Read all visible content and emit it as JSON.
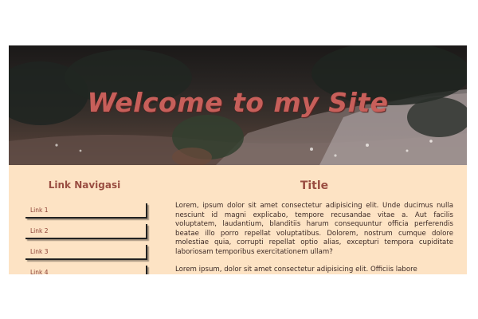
{
  "header": {
    "title": "Welcome to my Site"
  },
  "sidebar": {
    "title": "Link Navigasi",
    "links": [
      {
        "label": "Link 1"
      },
      {
        "label": "Link 2"
      },
      {
        "label": "Link 3"
      },
      {
        "label": "Link 4"
      }
    ]
  },
  "main": {
    "title": "Title",
    "paragraphs": [
      "Lorem, ipsum dolor sit amet consectetur adipisicing elit. Unde ducimus nulla nesciunt id magni explicabo, tempore recusandae vitae a. Aut facilis voluptatem, laudantium, blanditiis harum consequuntur officia perferendis beatae illo porro repellat voluptatibus. Dolorem, nostrum cumque dolore molestiae quia, corrupti repellat optio alias, excepturi tempora cupiditate laboriosam temporibus exercitationem ullam?",
      "Lorem ipsum, dolor sit amet consectetur adipisicing elit. Officiis labore"
    ]
  },
  "colors": {
    "background": "#fde3c4",
    "accent": "#9a4e42",
    "header_text": "#c75f5a"
  }
}
